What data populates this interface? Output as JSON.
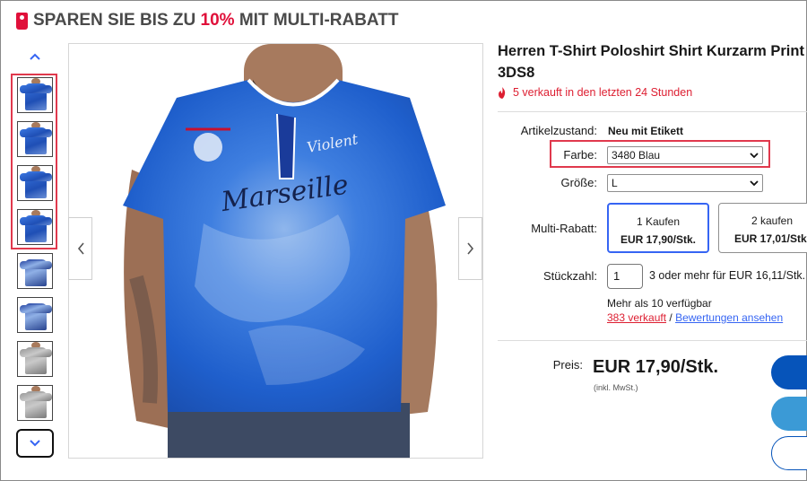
{
  "banner": {
    "prefix": "SPAREN SIE BIS ZU ",
    "percent": "10%",
    "suffix": " MIT MULTI-RABATT",
    "accent_color": "#e0103a"
  },
  "gallery": {
    "up_icon": "chevron-up-icon",
    "down_icon": "chevron-down-icon",
    "prev_icon": "chevron-left-icon",
    "next_icon": "chevron-right-icon",
    "thumbnail_count": 8
  },
  "product": {
    "title_line1": "Herren T-Shirt Poloshirt Shirt Kurzarm Print",
    "title_line2": "3DS8",
    "sold_text": "5 verkauft in den letzten 24 Stunden",
    "sold_icon": "fire-icon"
  },
  "specs": {
    "condition_label": "Artikelzustand:",
    "condition_value": "Neu mit Etikett",
    "color_label": "Farbe:",
    "color_value": "3480 Blau",
    "size_label": "Größe:",
    "size_value": "L",
    "multi_label": "Multi-Rabatt:",
    "multi_options": [
      {
        "qty": "1 Kaufen",
        "price": "EUR 17,90/Stk."
      },
      {
        "qty": "2 kaufen",
        "price": "EUR 17,01/Stk."
      }
    ],
    "qty_label": "Stückzahl:",
    "qty_value": "1",
    "qty_note": "3 oder mehr für EUR 16,11/Stk.",
    "available": "Mehr als 10 verfügbar",
    "sold_link": "383 verkauft",
    "separator": " / ",
    "reviews_link": "Bewertungen ansehen"
  },
  "pricing": {
    "label": "Preis:",
    "value": "EUR 17,90/Stk.",
    "tax_note": "(inkl. MwSt.)"
  },
  "colors": {
    "link_blue": "#3665f3",
    "highlight_red": "#e0394d",
    "button_blue": "#0654ba",
    "button_light": "#3b9ad6"
  }
}
